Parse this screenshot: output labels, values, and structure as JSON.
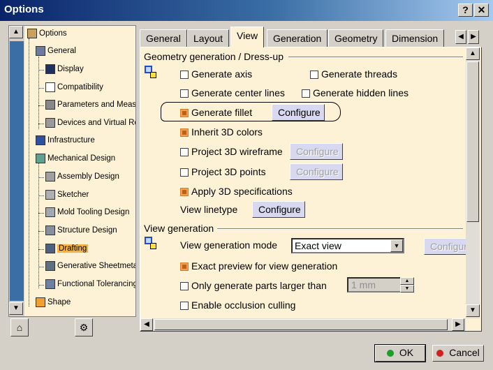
{
  "window": {
    "title": "Options",
    "help_btn": "?",
    "close_btn": "✕"
  },
  "tree": {
    "items": [
      {
        "label": "Options",
        "icon": "options-icon"
      },
      {
        "label": "General",
        "icon": "general-icon"
      },
      {
        "label": "Display",
        "icon": "display-icon"
      },
      {
        "label": "Compatibility",
        "icon": "compatibility-icon"
      },
      {
        "label": "Parameters and Measur",
        "icon": "parameters-icon"
      },
      {
        "label": "Devices and Virtual Rea",
        "icon": "devices-icon"
      },
      {
        "label": "Infrastructure",
        "icon": "infrastructure-icon"
      },
      {
        "label": "Mechanical Design",
        "icon": "mechanical-design-icon"
      },
      {
        "label": "Assembly Design",
        "icon": "assembly-icon"
      },
      {
        "label": "Sketcher",
        "icon": "sketcher-icon"
      },
      {
        "label": "Mold Tooling Design",
        "icon": "mold-icon"
      },
      {
        "label": "Structure Design",
        "icon": "structure-icon"
      },
      {
        "label": "Drafting",
        "icon": "drafting-icon",
        "selected": true
      },
      {
        "label": "Generative Sheetmetal",
        "icon": "sheetmetal-icon"
      },
      {
        "label": "Functional Tolerancing &",
        "icon": "tolerancing-icon"
      },
      {
        "label": "Shape",
        "icon": "shape-icon"
      }
    ]
  },
  "tabs": [
    "General",
    "Layout",
    "View",
    "Generation",
    "Geometry",
    "Dimension"
  ],
  "active_tab": "View",
  "geometry_group": {
    "title": "Geometry generation / Dress-up",
    "generate_axis": "Generate axis",
    "generate_threads": "Generate threads",
    "generate_center_lines": "Generate center lines",
    "generate_hidden_lines": "Generate hidden lines",
    "generate_fillet": "Generate fillet",
    "inherit_3d_colors": "Inherit 3D colors",
    "project_3d_wireframe": "Project 3D wireframe",
    "project_3d_points": "Project 3D points",
    "apply_3d_specs": "Apply 3D specifications",
    "view_linetype": "View linetype",
    "configure": "Configure"
  },
  "view_generation_group": {
    "title": "View generation",
    "mode_label": "View generation mode",
    "mode_value": "Exact view",
    "configure_partial": "Configur",
    "exact_preview": "Exact preview for view generation",
    "only_parts_larger": "Only generate parts larger than",
    "size_value": "1 mm",
    "occlusion": "Enable occlusion culling"
  },
  "dialog": {
    "ok": "OK",
    "cancel": "Cancel"
  },
  "colors": {
    "title_start": "#0a246a",
    "panel_bg": "#fdf2d6",
    "selected": "#f4b342"
  }
}
